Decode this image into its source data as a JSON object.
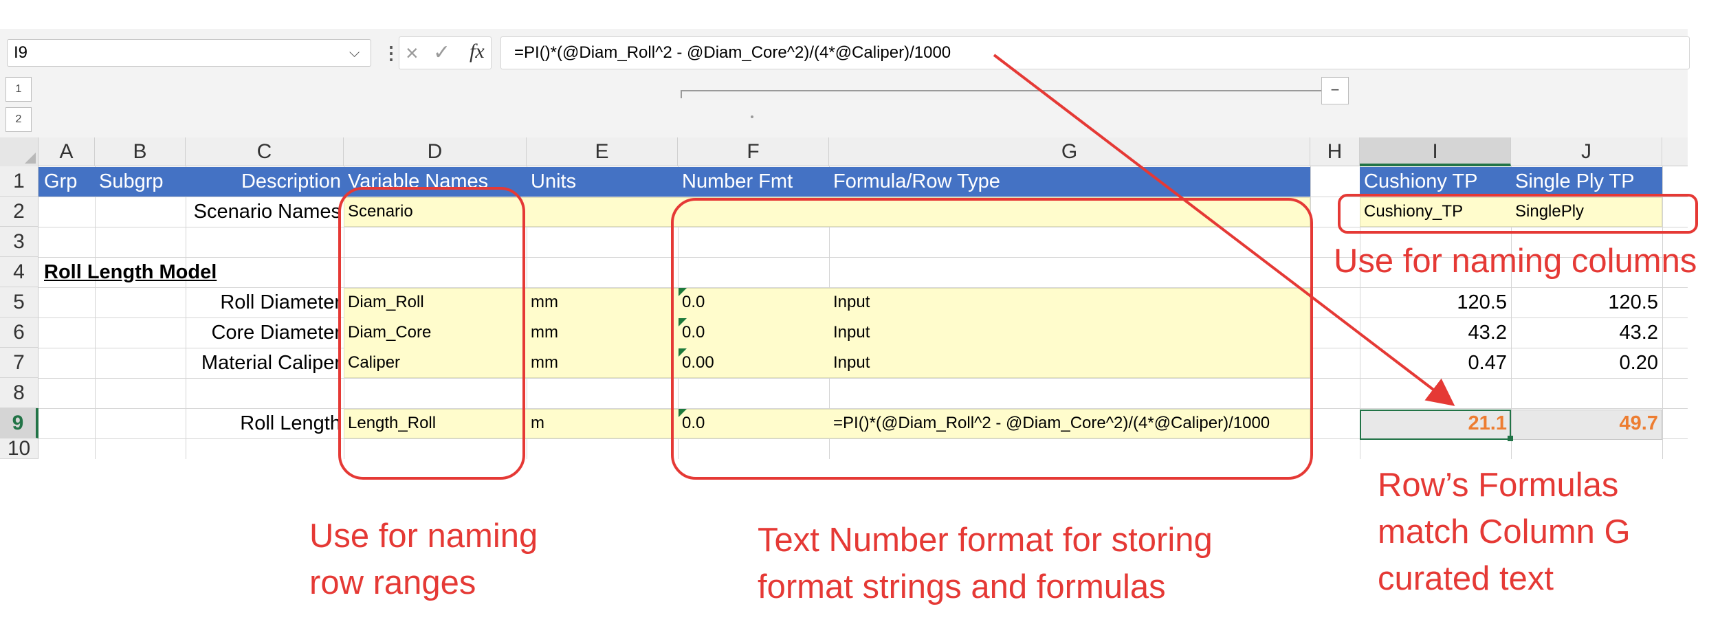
{
  "formula_bar": {
    "name_box": "I9",
    "cancel_icon": "×",
    "enter_icon": "✓",
    "fx_label": "fx",
    "formula": "=PI()*(@Diam_Roll^2 - @Diam_Core^2)/(4*@Caliper)/1000"
  },
  "outline": {
    "levels": [
      "1",
      "2"
    ],
    "collapse_symbol": "−"
  },
  "columns": [
    "A",
    "B",
    "C",
    "D",
    "E",
    "F",
    "G",
    "H",
    "I",
    "J"
  ],
  "selected_column": "I",
  "rows": [
    "1",
    "2",
    "3",
    "4",
    "5",
    "6",
    "7",
    "8",
    "9",
    "10"
  ],
  "selected_row": "9",
  "sheet": {
    "header": {
      "grp": "Grp",
      "subgrp": "Subgrp",
      "description": "Description",
      "variable_names": "Variable Names",
      "units": "Units",
      "number_fmt": "Number Fmt",
      "formula_row_type": "Formula/Row Type",
      "col_i": "Cushiony TP",
      "col_j": "Single Ply TP"
    },
    "r2": {
      "description": "Scenario Names",
      "variable": "Scenario",
      "col_i": "Cushiony_TP",
      "col_j": "SinglePly"
    },
    "r4": {
      "section": "Roll Length Model"
    },
    "r5": {
      "description": "Roll Diameter",
      "variable": "Diam_Roll",
      "units": "mm",
      "fmt": "0.0",
      "type": "Input",
      "col_i": "120.5",
      "col_j": "120.5"
    },
    "r6": {
      "description": "Core Diameter",
      "variable": "Diam_Core",
      "units": "mm",
      "fmt": "0.0",
      "type": "Input",
      "col_i": "43.2",
      "col_j": "43.2"
    },
    "r7": {
      "description": "Material Caliper",
      "variable": "Caliper",
      "units": "mm",
      "fmt": "0.00",
      "type": "Input",
      "col_i": "0.47",
      "col_j": "0.20"
    },
    "r9": {
      "description": "Roll Length",
      "variable": "Length_Roll",
      "units": "m",
      "fmt": "0.0",
      "type": "=PI()*(@Diam_Roll^2 - @Diam_Core^2)/(4*@Caliper)/1000",
      "col_i": "21.1",
      "col_j": "49.7"
    }
  },
  "annotations": {
    "naming_columns": "Use for naming columns",
    "naming_rows_1": "Use for naming",
    "naming_rows_2": "row ranges",
    "text_fmt_1": "Text Number format for storing",
    "text_fmt_2": "format strings and formulas",
    "row_formulas_1": "Row’s Formulas",
    "row_formulas_2": "match Column G",
    "row_formulas_3": "curated text"
  },
  "colors": {
    "header_blue": "#4472c4",
    "input_yellow": "#fffccc",
    "excel_green": "#217346",
    "annotation_red": "#e53935",
    "result_orange": "#ed7d31"
  }
}
